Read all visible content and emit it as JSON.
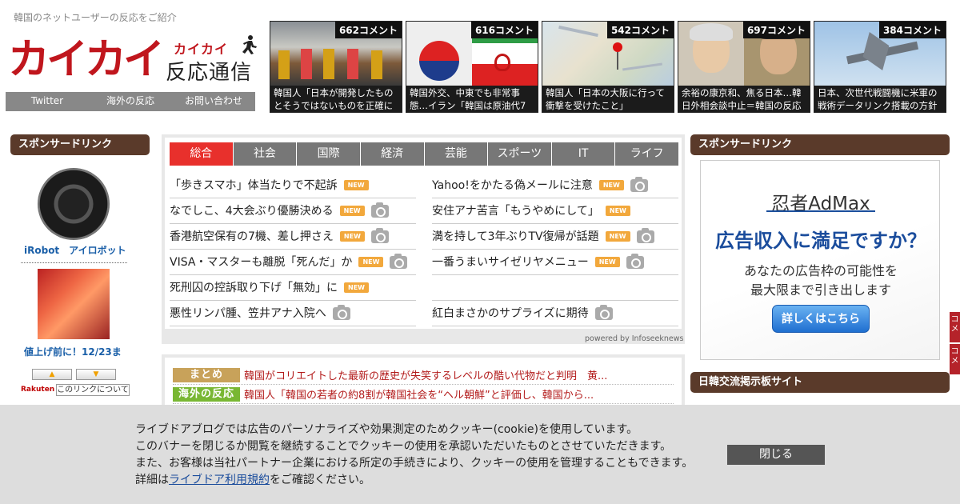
{
  "header": {
    "tagline": "韓国のネットユーザーの反応をご紹介",
    "logo_main": "カイカイ",
    "logo_small": "カイカイ",
    "logo_sub": "反応通信",
    "nav": [
      "Twitter",
      "海外の反応",
      "お問い合わせ"
    ]
  },
  "thumbnails": [
    {
      "count": "662コメント",
      "caption": "韓国人「日本が開発したものとそうではないものを正確に"
    },
    {
      "count": "616コメント",
      "caption": "韓国外交、中東でも非常事態…イラン「韓国は原油代7"
    },
    {
      "count": "542コメント",
      "caption": "韓国人「日本の大阪に行って衝撃を受けたこと」"
    },
    {
      "count": "697コメント",
      "caption": "余裕の康京和、焦る日本…韓日外相会談中止＝韓国の反応"
    },
    {
      "count": "384コメント",
      "caption": "日本、次世代戦闘機に米軍の戦術データリンク搭載の方針"
    }
  ],
  "left_sidebar": {
    "title": "スポンサードリンク",
    "product1": "iRobot　アイロボット",
    "product2": "値上げ前に！12/23ま",
    "rakuten": "Rakuten",
    "about_link": "このリンクについて"
  },
  "news": {
    "tabs": [
      "総合",
      "社会",
      "国際",
      "経済",
      "芸能",
      "スポーツ",
      "IT",
      "ライフ"
    ],
    "active_tab": "総合",
    "left": [
      {
        "title": "「歩きスマホ」体当たりで不起訴",
        "new": true,
        "photo": false
      },
      {
        "title": "なでしこ、4大会ぶり優勝決める",
        "new": true,
        "photo": true
      },
      {
        "title": "香港航空保有の7機、差し押さえ",
        "new": true,
        "photo": true
      },
      {
        "title": "VISA・マスターも離脱「死んだ」か",
        "new": true,
        "photo": true
      },
      {
        "title": "死刑囚の控訴取り下げ「無効」に",
        "new": true,
        "photo": false
      },
      {
        "title": "悪性リンパ腫、笠井アナ入院へ",
        "new": false,
        "photo": true
      }
    ],
    "right": [
      {
        "title": "Yahoo!をかたる偽メールに注意",
        "new": true,
        "photo": true
      },
      {
        "title": "安住アナ苦言「もうやめにして」",
        "new": true,
        "photo": false
      },
      {
        "title": "満を持して3年ぶりTV復帰が話題",
        "new": true,
        "photo": true
      },
      {
        "title": "一番うまいサイゼリヤメニュー",
        "new": true,
        "photo": true
      },
      {
        "title": "",
        "new": false,
        "photo": false
      },
      {
        "title": "紅白まさかのサプライズに期待",
        "new": false,
        "photo": true
      }
    ],
    "badge_label": "NEW",
    "powered": "powered by Infoseeknews"
  },
  "matome": [
    {
      "tag": "まとめ",
      "tag_color": "#c8a25a",
      "text": "韓国がコリエイトした最新の歴史が失笑するレベルの酷い代物だと判明　黄..."
    },
    {
      "tag": "海外の反応",
      "tag_color": "#79b733",
      "text": "韓国人「韓国の若者の約8割が韓国社会を“ヘル朝鮮”と評価し、韓国から..."
    }
  ],
  "right_sidebar": {
    "title": "スポンサードリンク",
    "ad_brand": "忍者AdMax",
    "ad_head": "広告収入に満足ですか？",
    "ad_line1": "あなたの広告枠の可能性を",
    "ad_line2": "最大限まで引き出します",
    "ad_button": "詳しくはこちら",
    "section2": "日韓交流掲示板サイト",
    "side_tabs": [
      "コメ",
      "コメ"
    ]
  },
  "cookie_banner": {
    "line1": "ライブドアブログでは広告のパーソナライズや効果測定のためクッキー(cookie)を使用しています。",
    "line2": "このバナーを閉じるか閲覧を継続することでクッキーの使用を承認いただいたものとさせていただきます。",
    "line3": "また、お客様は当社パートナー企業における所定の手続きにより、クッキーの使用を管理することもできます。",
    "line4_prefix": "詳細は",
    "line4_link": "ライブドア利用規約",
    "line4_suffix": "をご確認ください。",
    "close": "閉じる"
  },
  "colors": {
    "brand_red": "#c0161d",
    "tab_active": "#e8302c",
    "sidebar_header": "#5a3a2a",
    "new_badge": "#f2a83c"
  }
}
